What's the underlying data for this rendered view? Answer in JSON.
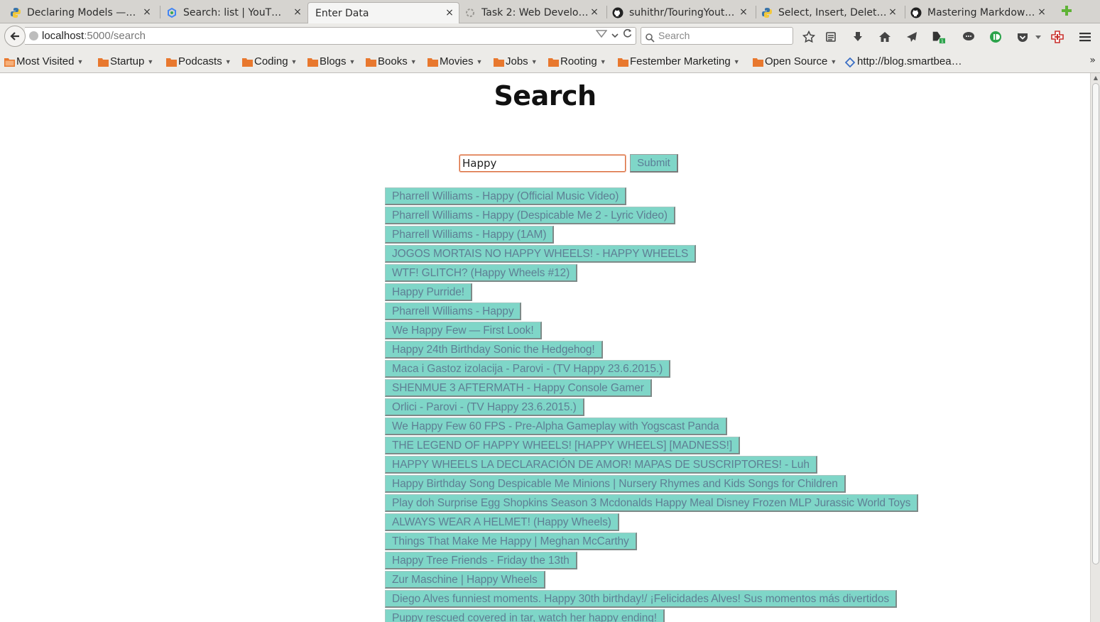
{
  "tabs": [
    {
      "title": "Declaring Models —…",
      "icon": "python-icon",
      "active": false
    },
    {
      "title": "Search: list  |  YouT…",
      "icon": "google-apis-icon",
      "active": false
    },
    {
      "title": "Enter Data",
      "icon": "",
      "active": true
    },
    {
      "title": "Task 2: Web Develo…",
      "icon": "loading-icon",
      "active": false
    },
    {
      "title": "suhithr/TouringYout…",
      "icon": "github-icon",
      "active": false
    },
    {
      "title": "Select, Insert, Delet…",
      "icon": "python-icon",
      "active": false
    },
    {
      "title": "Mastering Markdow…",
      "icon": "github-icon",
      "active": false
    }
  ],
  "tab_close_label": "×",
  "navbar": {
    "url_host": "localhost",
    "url_path": ":5000/search",
    "search_placeholder": "Search"
  },
  "bookmarks": [
    {
      "label": "Most Visited",
      "type": "folder"
    },
    {
      "label": "Startup",
      "type": "folder"
    },
    {
      "label": "Podcasts",
      "type": "folder"
    },
    {
      "label": "Coding",
      "type": "folder"
    },
    {
      "label": "Blogs",
      "type": "folder"
    },
    {
      "label": "Books",
      "type": "folder"
    },
    {
      "label": "Movies",
      "type": "folder"
    },
    {
      "label": "Jobs",
      "type": "folder"
    },
    {
      "label": "Rooting",
      "type": "folder"
    },
    {
      "label": "Festember Marketing",
      "type": "folder"
    },
    {
      "label": "Open Source",
      "type": "folder"
    },
    {
      "label": "http://blog.smartbea…",
      "type": "link"
    }
  ],
  "page": {
    "title": "Search",
    "search_value": "Happy",
    "submit_label": "Submit"
  },
  "results": [
    "Pharrell Williams - Happy (Official Music Video)",
    "Pharrell Williams - Happy (Despicable Me 2 - Lyric Video)",
    "Pharrell Williams - Happy (1AM)",
    "JOGOS MORTAIS NO HAPPY WHEELS! - HAPPY WHEELS",
    "WTF! GLITCH? (Happy Wheels #12)",
    "Happy Purride!",
    "Pharrell Williams - Happy",
    "We Happy Few — First Look!",
    "Happy 24th Birthday Sonic the Hedgehog!",
    "Maca i Gastoz izolacija - Parovi - (TV Happy 23.6.2015.)",
    "SHENMUE 3 AFTERMATH - Happy Console Gamer",
    "Orlici - Parovi - (TV Happy 23.6.2015.)",
    "We Happy Few 60 FPS - Pre-Alpha Gameplay with Yogscast Panda",
    "THE LEGEND OF HAPPY WHEELS! [HAPPY WHEELS] [MADNESS!]",
    "HAPPY WHEELS LA DECLARACIÓN DE AMOR! MAPAS DE SUSCRIPTORES! - Luh",
    "Happy Birthday Song Despicable Me Minions | Nursery Rhymes and Kids Songs for Children",
    "Play doh Surprise Egg Shopkins Season 3 Mcdonalds Happy Meal Disney Frozen MLP Jurassic World Toys",
    "ALWAYS WEAR A HELMET! (Happy Wheels)",
    "Things That Make Me Happy | Meghan McCarthy",
    "Happy Tree Friends - Friday the 13th",
    "Zur Maschine | Happy Wheels",
    "Diego Alves funniest moments. Happy 30th birthday!/ ¡Felicidades Alves! Sus momentos más divertidos",
    "Puppy rescued covered in tar, watch her happy ending!"
  ],
  "colors": {
    "button_bg": "#7fd6c8",
    "button_text": "#5e7f94",
    "input_focus_border": "#d96c3c"
  }
}
